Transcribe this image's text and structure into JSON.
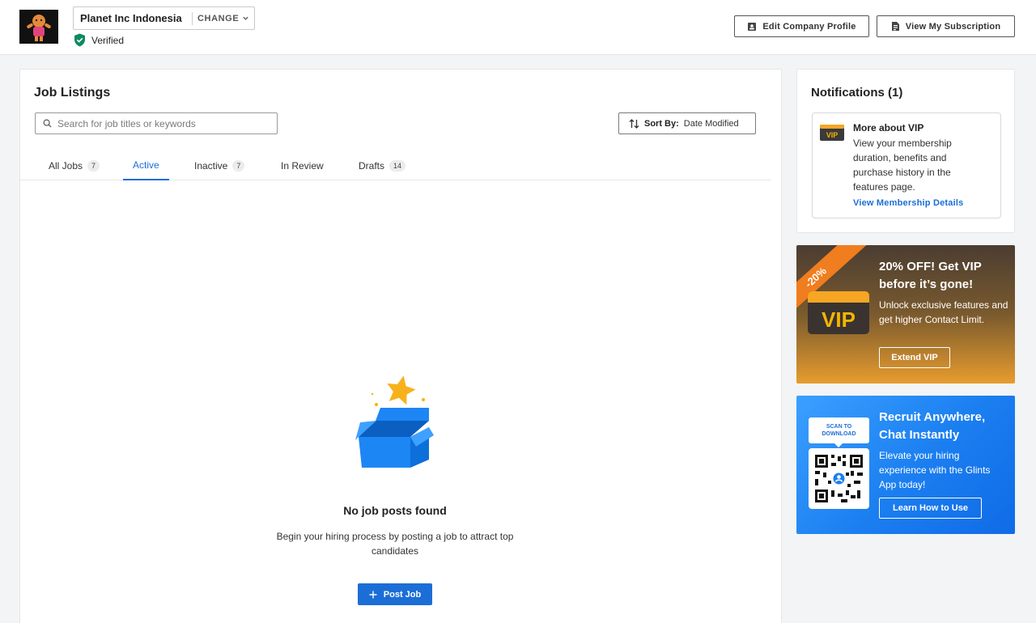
{
  "header": {
    "company_name": "Planet Inc Indonesia",
    "change_label": "CHANGE",
    "verified_label": "Verified",
    "edit_profile_label": "Edit Company Profile",
    "view_subscription_label": "View My Subscription"
  },
  "job_listings": {
    "title": "Job Listings",
    "search_placeholder": "Search for job titles or keywords",
    "sort_label": "Sort By:",
    "sort_value": "Date Modified",
    "tabs": [
      {
        "label": "All Jobs",
        "count": "7"
      },
      {
        "label": "Active",
        "count": ""
      },
      {
        "label": "Inactive",
        "count": "7"
      },
      {
        "label": "In Review",
        "count": ""
      },
      {
        "label": "Drafts",
        "count": "14"
      }
    ],
    "active_tab": "Active",
    "empty_title": "No job posts found",
    "empty_desc": "Begin your hiring process by posting a job to attract top candidates",
    "post_job_label": "Post Job"
  },
  "notifications": {
    "title": "Notifications (1)",
    "items": [
      {
        "icon": "vip-icon",
        "icon_text": "VIP",
        "title": "More about VIP",
        "body": "View your membership duration, benefits and purchase history in the features page.",
        "link": "View Membership Details"
      }
    ]
  },
  "promo_vip": {
    "ribbon": "-20%",
    "badge_text": "VIP",
    "title": "20% OFF! Get VIP before it’s gone!",
    "desc": "Unlock exclusive features and get higher Contact Limit.",
    "button": "Extend VIP"
  },
  "promo_app": {
    "scan_label": "SCAN TO DOWNLOAD",
    "title": "Recruit Anywhere, Chat Instantly",
    "desc": "Elevate your hiring experience with the Glints App today!",
    "button": "Learn How to Use"
  },
  "colors": {
    "primary": "#1b6ed6",
    "verified_green": "#0f8a5f",
    "vip_orange": "#f07d1e"
  }
}
